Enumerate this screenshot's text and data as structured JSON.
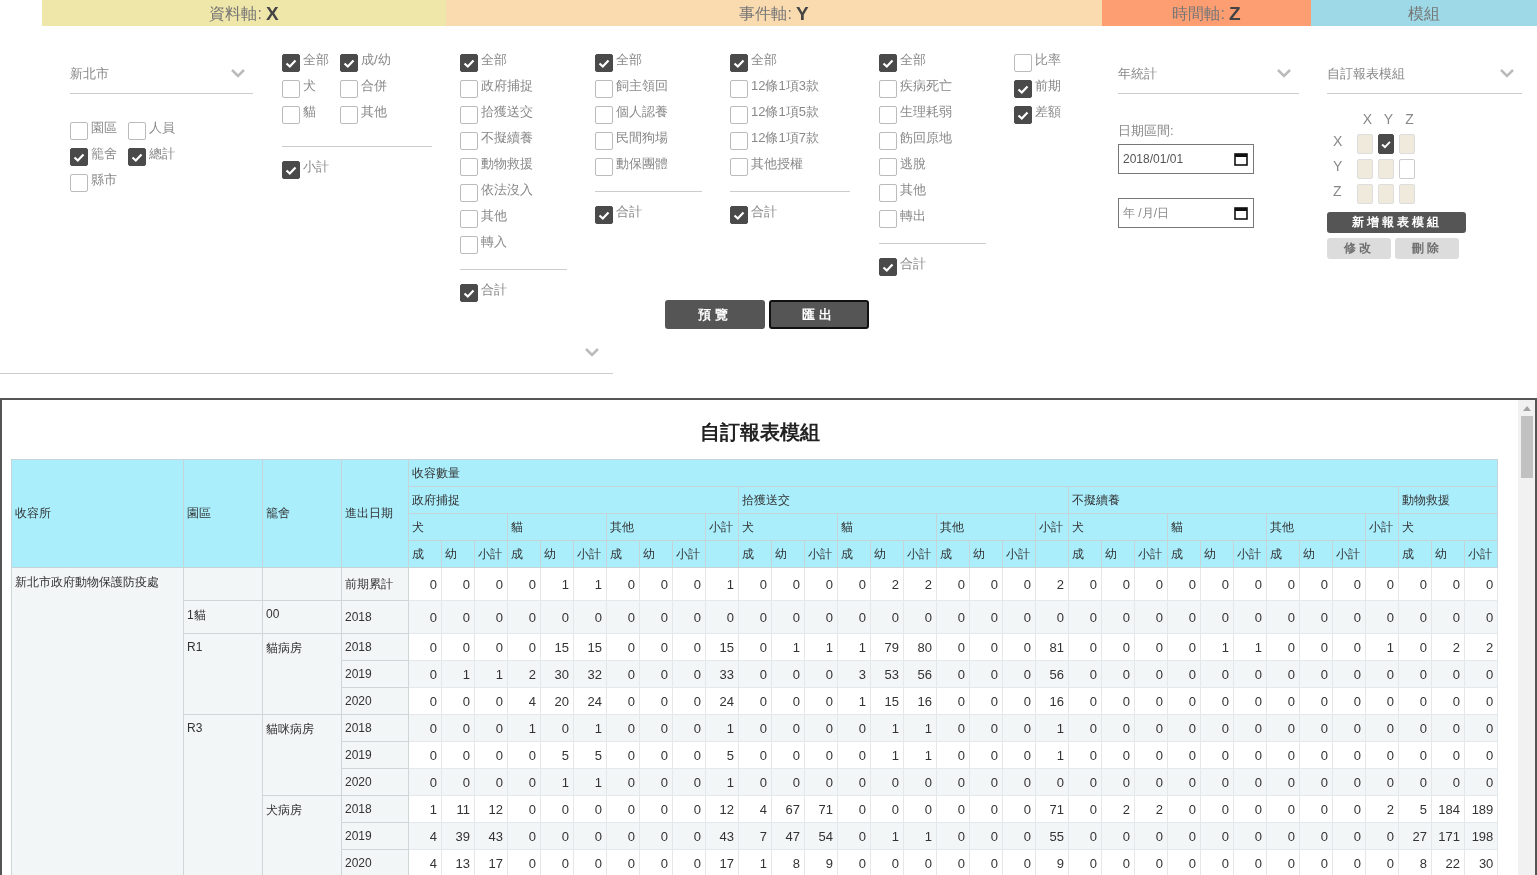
{
  "axis_bands": [
    {
      "label": "資料軸:",
      "axis": "X",
      "color": "#efe6a9"
    },
    {
      "label": "事件軸:",
      "axis": "Y",
      "color": "#fadbb0"
    },
    {
      "label": "時間軸:",
      "axis": "Z",
      "color": "#fd9d72"
    },
    {
      "label": "模組",
      "color": "#9dd9e7"
    }
  ],
  "data_axis": {
    "region_select": "新北市",
    "level_options": [
      {
        "label": "園區",
        "checked": false
      },
      {
        "label": "人員",
        "checked": false
      },
      {
        "label": "籠舍",
        "checked": true
      },
      {
        "label": "總計",
        "checked": true
      },
      {
        "label": "縣市",
        "checked": false
      }
    ],
    "animal_options": [
      {
        "label": "全部",
        "checked": true
      },
      {
        "label": "成/幼",
        "checked": true
      },
      {
        "label": "犬",
        "checked": false
      },
      {
        "label": "合併",
        "checked": false
      },
      {
        "label": "貓",
        "checked": false
      },
      {
        "label": "其他",
        "checked": false
      }
    ],
    "animal_total": {
      "label": "小計",
      "checked": true
    }
  },
  "event_axis": {
    "columns": [
      {
        "items": [
          {
            "label": "全部",
            "checked": true
          },
          {
            "label": "政府捕捉",
            "checked": false
          },
          {
            "label": "拾獲送交",
            "checked": false
          },
          {
            "label": "不擬續養",
            "checked": false
          },
          {
            "label": "動物救援",
            "checked": false
          },
          {
            "label": "依法沒入",
            "checked": false
          },
          {
            "label": "其他",
            "checked": false
          },
          {
            "label": "轉入",
            "checked": false
          }
        ],
        "total": {
          "label": "合計",
          "checked": true
        }
      },
      {
        "items": [
          {
            "label": "全部",
            "checked": true
          },
          {
            "label": "飼主領回",
            "checked": false
          },
          {
            "label": "個人認養",
            "checked": false
          },
          {
            "label": "民間狗場",
            "checked": false
          },
          {
            "label": "動保團體",
            "checked": false
          }
        ],
        "total": {
          "label": "合計",
          "checked": true
        }
      },
      {
        "items": [
          {
            "label": "全部",
            "checked": true
          },
          {
            "label": "12條1項3款",
            "checked": false
          },
          {
            "label": "12條1項5款",
            "checked": false
          },
          {
            "label": "12條1項7款",
            "checked": false
          },
          {
            "label": "其他授權",
            "checked": false
          }
        ],
        "total": {
          "label": "合計",
          "checked": true
        }
      },
      {
        "items": [
          {
            "label": "全部",
            "checked": true
          },
          {
            "label": "疾病死亡",
            "checked": false
          },
          {
            "label": "生理耗弱",
            "checked": false
          },
          {
            "label": "飭回原地",
            "checked": false
          },
          {
            "label": "逃脫",
            "checked": false
          },
          {
            "label": "其他",
            "checked": false
          },
          {
            "label": "轉出",
            "checked": false
          }
        ],
        "total": {
          "label": "合計",
          "checked": true
        }
      },
      {
        "items": [
          {
            "label": "比率",
            "checked": false
          },
          {
            "label": "前期",
            "checked": true
          },
          {
            "label": "差額",
            "checked": true
          }
        ]
      }
    ],
    "actions": [
      {
        "label": "預覽",
        "focused": false
      },
      {
        "label": "匯出",
        "focused": true
      }
    ]
  },
  "time_axis": {
    "period_select": "年統計",
    "date_label": "日期區間:",
    "dates": [
      {
        "value": "2018/01/01"
      },
      {
        "placeholder": "年 /月/日"
      }
    ]
  },
  "module": {
    "template_select": "自訂報表模組",
    "matrix": {
      "columns": [
        "X",
        "Y",
        "Z"
      ],
      "rows": [
        {
          "label": "X",
          "cells": [
            {
              "checked": false,
              "disabled": true
            },
            {
              "checked": true,
              "disabled": false
            },
            {
              "checked": false,
              "disabled": true
            }
          ]
        },
        {
          "label": "Y",
          "cells": [
            {
              "checked": false,
              "disabled": true
            },
            {
              "checked": false,
              "disabled": true
            },
            {
              "checked": false,
              "disabled": false
            }
          ]
        },
        {
          "label": "Z",
          "cells": [
            {
              "checked": false,
              "disabled": true
            },
            {
              "checked": false,
              "disabled": true
            },
            {
              "checked": false,
              "disabled": true
            }
          ]
        }
      ]
    },
    "buttons": [
      {
        "label": "新增報表模組",
        "disabled": false
      },
      {
        "label": "修改",
        "disabled": true
      },
      {
        "label": "刪除",
        "disabled": true
      }
    ]
  },
  "report": {
    "title": "自訂報表模組",
    "table": {
      "row_headers": [
        "收容所",
        "園區",
        "籠舍",
        "進出日期"
      ],
      "group": "收容數量",
      "categories": [
        {
          "name": "政府捕捉",
          "species": [
            {
              "name": "犬",
              "columns": [
                "成",
                "幼",
                "小計"
              ]
            },
            {
              "name": "貓",
              "columns": [
                "成",
                "幼",
                "小計"
              ]
            },
            {
              "name": "其他",
              "columns": [
                "成",
                "幼",
                "小計"
              ]
            }
          ],
          "subtotal": "小計"
        },
        {
          "name": "拾獲送交",
          "species": [
            {
              "name": "犬",
              "columns": [
                "成",
                "幼",
                "小計"
              ]
            },
            {
              "name": "貓",
              "columns": [
                "成",
                "幼",
                "小計"
              ]
            },
            {
              "name": "其他",
              "columns": [
                "成",
                "幼",
                "小計"
              ]
            }
          ],
          "subtotal": "小計"
        },
        {
          "name": "不擬續養",
          "species": [
            {
              "name": "犬",
              "columns": [
                "成",
                "幼",
                "小計"
              ]
            },
            {
              "name": "貓",
              "columns": [
                "成",
                "幼",
                "小計"
              ]
            },
            {
              "name": "其他",
              "columns": [
                "成",
                "幼",
                "小計"
              ]
            }
          ],
          "subtotal": "小計"
        },
        {
          "name": "動物救援",
          "species": [
            {
              "name": "犬",
              "columns": [
                "成",
                "幼",
                "小計"
              ]
            }
          ]
        }
      ],
      "shelters": [
        {
          "name": "新北市政府動物保護防疫處",
          "zones": [
            {
              "cages": [
                {
                  "rows": [
                    {
                      "date": "前期累計",
                      "values": [
                        "0",
                        "0",
                        "0",
                        "0",
                        "1",
                        "1",
                        "0",
                        "0",
                        "0",
                        "1",
                        "0",
                        "0",
                        "0",
                        "0",
                        "2",
                        "2",
                        "0",
                        "0",
                        "0",
                        "2",
                        "0",
                        "0",
                        "0",
                        "0",
                        "0",
                        "0",
                        "0",
                        "0",
                        "0",
                        "0",
                        "0",
                        "0",
                        "0"
                      ]
                    }
                  ]
                }
              ]
            },
            {
              "name": "1貓",
              "cages": [
                {
                  "name": "00",
                  "rows": [
                    {
                      "date": "2018",
                      "values": [
                        "0",
                        "0",
                        "0",
                        "0",
                        "0",
                        "0",
                        "0",
                        "0",
                        "0",
                        "0",
                        "0",
                        "0",
                        "0",
                        "0",
                        "0",
                        "0",
                        "0",
                        "0",
                        "0",
                        "0",
                        "0",
                        "0",
                        "0",
                        "0",
                        "0",
                        "0",
                        "0",
                        "0",
                        "0",
                        "0",
                        "0",
                        "0",
                        "0"
                      ]
                    }
                  ]
                }
              ]
            },
            {
              "name": "R1",
              "cages": [
                {
                  "name": "貓病房",
                  "rows": [
                    {
                      "date": "2018",
                      "values": [
                        "0",
                        "0",
                        "0",
                        "0",
                        "15",
                        "15",
                        "0",
                        "0",
                        "0",
                        "15",
                        "0",
                        "1",
                        "1",
                        "1",
                        "79",
                        "80",
                        "0",
                        "0",
                        "0",
                        "81",
                        "0",
                        "0",
                        "0",
                        "0",
                        "1",
                        "1",
                        "0",
                        "0",
                        "0",
                        "1",
                        "0",
                        "2",
                        "2"
                      ]
                    },
                    {
                      "date": "2019",
                      "values": [
                        "0",
                        "1",
                        "1",
                        "2",
                        "30",
                        "32",
                        "0",
                        "0",
                        "0",
                        "33",
                        "0",
                        "0",
                        "0",
                        "3",
                        "53",
                        "56",
                        "0",
                        "0",
                        "0",
                        "56",
                        "0",
                        "0",
                        "0",
                        "0",
                        "0",
                        "0",
                        "0",
                        "0",
                        "0",
                        "0",
                        "0",
                        "0",
                        "0"
                      ]
                    },
                    {
                      "date": "2020",
                      "values": [
                        "0",
                        "0",
                        "0",
                        "4",
                        "20",
                        "24",
                        "0",
                        "0",
                        "0",
                        "24",
                        "0",
                        "0",
                        "0",
                        "1",
                        "15",
                        "16",
                        "0",
                        "0",
                        "0",
                        "16",
                        "0",
                        "0",
                        "0",
                        "0",
                        "0",
                        "0",
                        "0",
                        "0",
                        "0",
                        "0",
                        "0",
                        "0",
                        "0"
                      ]
                    }
                  ]
                }
              ]
            },
            {
              "name": "R3",
              "cages": [
                {
                  "name": "貓咪病房",
                  "rows": [
                    {
                      "date": "2018",
                      "values": [
                        "0",
                        "0",
                        "0",
                        "1",
                        "0",
                        "1",
                        "0",
                        "0",
                        "0",
                        "1",
                        "0",
                        "0",
                        "0",
                        "0",
                        "1",
                        "1",
                        "0",
                        "0",
                        "0",
                        "1",
                        "0",
                        "0",
                        "0",
                        "0",
                        "0",
                        "0",
                        "0",
                        "0",
                        "0",
                        "0",
                        "0",
                        "0",
                        "0"
                      ]
                    },
                    {
                      "date": "2019",
                      "values": [
                        "0",
                        "0",
                        "0",
                        "0",
                        "5",
                        "5",
                        "0",
                        "0",
                        "0",
                        "5",
                        "0",
                        "0",
                        "0",
                        "0",
                        "1",
                        "1",
                        "0",
                        "0",
                        "0",
                        "1",
                        "0",
                        "0",
                        "0",
                        "0",
                        "0",
                        "0",
                        "0",
                        "0",
                        "0",
                        "0",
                        "0",
                        "0",
                        "0"
                      ]
                    },
                    {
                      "date": "2020",
                      "values": [
                        "0",
                        "0",
                        "0",
                        "0",
                        "1",
                        "1",
                        "0",
                        "0",
                        "0",
                        "1",
                        "0",
                        "0",
                        "0",
                        "0",
                        "0",
                        "0",
                        "0",
                        "0",
                        "0",
                        "0",
                        "0",
                        "0",
                        "0",
                        "0",
                        "0",
                        "0",
                        "0",
                        "0",
                        "0",
                        "0",
                        "0",
                        "0",
                        "0"
                      ]
                    }
                  ]
                },
                {
                  "name": "犬病房",
                  "rows": [
                    {
                      "date": "2018",
                      "values": [
                        "1",
                        "11",
                        "12",
                        "0",
                        "0",
                        "0",
                        "0",
                        "0",
                        "0",
                        "12",
                        "4",
                        "67",
                        "71",
                        "0",
                        "0",
                        "0",
                        "0",
                        "0",
                        "0",
                        "71",
                        "0",
                        "2",
                        "2",
                        "0",
                        "0",
                        "0",
                        "0",
                        "0",
                        "0",
                        "2",
                        "5",
                        "184",
                        "189"
                      ]
                    },
                    {
                      "date": "2019",
                      "values": [
                        "4",
                        "39",
                        "43",
                        "0",
                        "0",
                        "0",
                        "0",
                        "0",
                        "0",
                        "43",
                        "7",
                        "47",
                        "54",
                        "0",
                        "1",
                        "1",
                        "0",
                        "0",
                        "0",
                        "55",
                        "0",
                        "0",
                        "0",
                        "0",
                        "0",
                        "0",
                        "0",
                        "0",
                        "0",
                        "0",
                        "27",
                        "171",
                        "198"
                      ]
                    },
                    {
                      "date": "2020",
                      "values": [
                        "4",
                        "13",
                        "17",
                        "0",
                        "0",
                        "0",
                        "0",
                        "0",
                        "0",
                        "17",
                        "1",
                        "8",
                        "9",
                        "0",
                        "0",
                        "0",
                        "0",
                        "0",
                        "0",
                        "9",
                        "0",
                        "0",
                        "0",
                        "0",
                        "0",
                        "0",
                        "0",
                        "0",
                        "0",
                        "0",
                        "8",
                        "22",
                        "30"
                      ]
                    }
                  ]
                }
              ]
            }
          ]
        }
      ]
    }
  }
}
